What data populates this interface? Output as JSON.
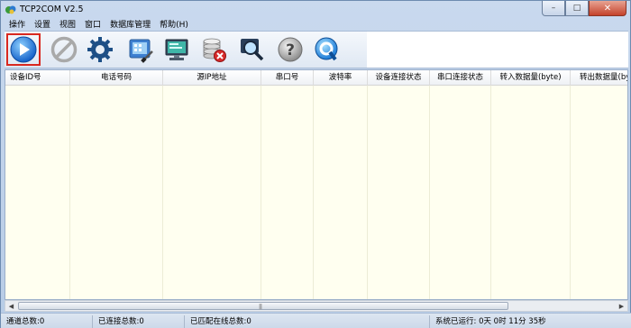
{
  "window": {
    "title": "TCP2COM V2.5",
    "controls": {
      "minimize": "–",
      "maximize": "□",
      "close": "✕"
    }
  },
  "menu": [
    "操作",
    "设置",
    "视图",
    "窗口",
    "数据库管理",
    "帮助(H)"
  ],
  "toolbar": [
    {
      "name": "start-button",
      "icon": "play-icon",
      "active": true
    },
    {
      "name": "stop-button",
      "icon": "prohibited-icon"
    },
    {
      "name": "settings-button",
      "icon": "gear-icon"
    },
    {
      "name": "device-config-button",
      "icon": "tablet-pen-icon"
    },
    {
      "name": "monitor-button",
      "icon": "computer-monitor-icon"
    },
    {
      "name": "database-delete-button",
      "icon": "database-delete-icon"
    },
    {
      "name": "search-button",
      "icon": "magnifier-icon"
    },
    {
      "name": "help-button",
      "icon": "help-icon"
    },
    {
      "name": "refresh-button",
      "icon": "quicktime-icon"
    }
  ],
  "table": {
    "columns": [
      "设备ID号",
      "电话号码",
      "源IP地址",
      "串口号",
      "波特率",
      "设备连接状态",
      "串口连接状态",
      "转入数据量(byte)",
      "转出数据量(by"
    ],
    "rows": []
  },
  "status": {
    "channels": "通道总数:0",
    "connected": "已连接总数:0",
    "online": "已匹配在线总数:0",
    "runtime": "系统已运行: 0天  0时 11分 35秒"
  },
  "colors": {
    "grid_background": "#fffff0",
    "active_outline": "#d9281f"
  }
}
